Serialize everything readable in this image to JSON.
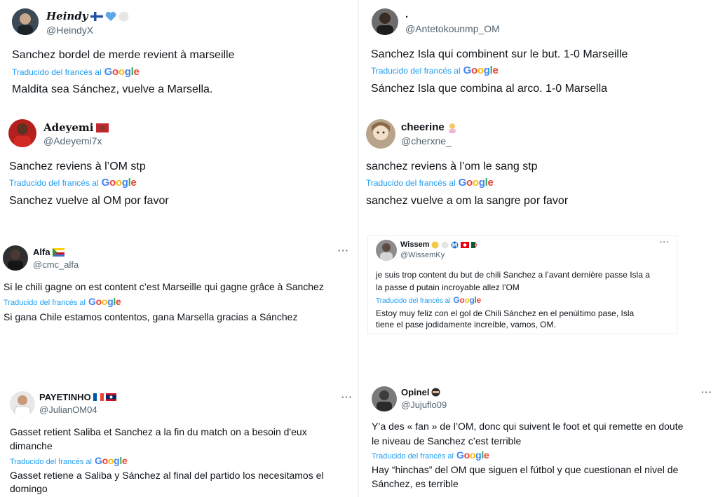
{
  "translate_prefix": "Traducido del francés al",
  "google_letters": [
    "G",
    "o",
    "o",
    "g",
    "l",
    "e"
  ],
  "tweets": [
    {
      "name": "Heindy",
      "handle": "@HeindyX",
      "original": "Sanchez bordel de merde revient à marseille",
      "translation": "Maldita sea Sánchez, vuelve a Marsella."
    },
    {
      "name": ".",
      "handle": "@Antetokounmp_OM",
      "original": "Sanchez Isla qui combinent sur le but. 1-0 Marseille",
      "translation": "Sánchez Isla que combina al arco. 1-0 Marsella"
    },
    {
      "name": "Adeyemi",
      "handle": "@Adeyemi7x",
      "original": "Sanchez reviens à l’OM stp",
      "translation": "Sanchez vuelve al OM por favor"
    },
    {
      "name": "cheerine",
      "handle": "@cherxne_",
      "original": "sanchez reviens à l’om le sang stp",
      "translation": "sanchez vuelve a om la sangre por favor"
    },
    {
      "name": "Alfa",
      "handle": "@cmc_alfa",
      "original": "Si le chili gagne on est content c’est Marseille qui gagne grâce à Sanchez",
      "translation": "Si gana Chile estamos contentos, gana Marsella gracias a Sánchez"
    },
    {
      "name": "Wissem",
      "handle": "@WissemKy",
      "original_lines": [
        "je suis trop content du but de chili Sanchez a l’avant dernière passe Isla a",
        "la passe d putain incroyable allez l’OM"
      ],
      "translation_lines": [
        "Estoy muy feliz con el gol de Chili Sánchez en el penúltimo pase, Isla",
        "tiene el pase jodidamente increíble, vamos, OM."
      ]
    },
    {
      "name": "PAYETINHO",
      "handle": "@JulianOM04",
      "original_lines": [
        "Gasset retient Saliba et Sanchez a la fin du match on a besoin d'eux",
        "dimanche"
      ],
      "translation_lines": [
        "Gasset retiene a Saliba y Sánchez al final del partido los necesitamos el",
        "domingo"
      ]
    },
    {
      "name": "Opinel",
      "handle": "@Jujuflo09",
      "original_lines": [
        "Y’a des « fan » de l’OM, donc qui suivent le foot et qui remette en doute",
        "le niveau de Sanchez c’est terrible"
      ],
      "translation_lines": [
        "Hay “hinchas” del OM que siguen el fútbol y que cuestionan el nivel de",
        "Sánchez, es terrible"
      ]
    }
  ],
  "more_label": "···",
  "colors": {
    "link": "#1d9bf0",
    "muted": "#536471",
    "text": "#0f1419"
  }
}
